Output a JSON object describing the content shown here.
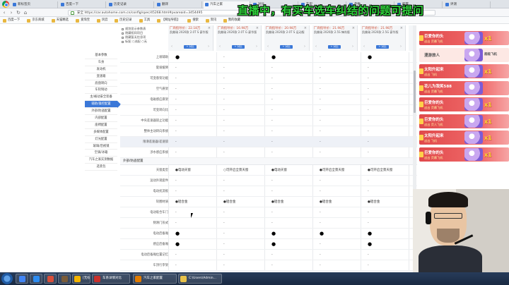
{
  "browser": {
    "tabs": [
      {
        "label": "新标签页",
        "active": false
      },
      {
        "label": "百度一下",
        "active": false
      },
      {
        "label": "历史记录",
        "active": false
      },
      {
        "label": "翻译",
        "active": false
      },
      {
        "label": "汽车之家",
        "active": true
      },
      {
        "label": "对比",
        "active": false
      },
      {
        "label": "车型",
        "active": false
      },
      {
        "label": "参数",
        "active": false
      },
      {
        "label": "配置",
        "active": false
      },
      {
        "label": "评测",
        "active": false
      }
    ],
    "url": "https://car.autohome.com.cn/config/spec/45268.html#pvareaid=3454495",
    "secure_label": "安全"
  },
  "bookmarks": [
    "百度一下",
    "京东商城",
    "天猫精选",
    "爱淘宝",
    "风云",
    "历史记录",
    "工具",
    "【网址导航】",
    "搜索",
    "资讯",
    "我的收藏"
  ],
  "banner": "直播中，有买车选车纠结的问题可提问",
  "tree": [
    "规划显示参数表",
    "隐藏相同项目",
    "隐藏暂无信息项",
    "标配  ○选配  ○无"
  ],
  "columns": [
    {
      "price": "厂商指导价：22.18万",
      "name": "凯美瑞 2020款 2.0T S 豪华版",
      "add": "+ 对比"
    },
    {
      "price": "厂商指导价：16.98万",
      "name": "凯美瑞 2020款 2.0T G 豪华版",
      "add": "+ 对比"
    },
    {
      "price": "厂商指导价：20.98万",
      "name": "凯美瑞 2020款 2.0T S 运动版",
      "add": "+ 对比"
    },
    {
      "price": "厂商指导价：21.98万",
      "name": "凯美瑞 2020款 2.5S 锋尚版",
      "add": "+ 对比"
    },
    {
      "price": "厂商指导价：21.98万",
      "name": "凯美瑞 2020款 2.5G 豪华版",
      "add": "+ 对比"
    },
    {
      "price": "厂商指导价：24.98万",
      "name": "凯美瑞 2020款 2.5Q 旗舰版",
      "add": "+ 对比"
    }
  ],
  "sidenav": {
    "items": [
      "基本参数",
      "车身",
      "发动机",
      "变速箱",
      "底盘转向",
      "车轮制动",
      "主/被动安全装备",
      "辅助/操控配置",
      "外部/防盗配置",
      "内部配置",
      "座椅配置",
      "多媒体配置",
      "灯光配置",
      "玻璃/后视镜",
      "空调/冰箱",
      "汽车之家实测数据",
      "选装包"
    ],
    "active_index": 7
  },
  "table": {
    "rows_top": [
      {
        "label": "上坡辅助",
        "cells": [
          "●",
          "-",
          "●",
          "-",
          "●",
          "-"
        ]
      },
      {
        "label": "陡坡缓降",
        "cells": [
          "-",
          "-",
          "-",
          "-",
          "-",
          "-"
        ]
      },
      {
        "label": "可变悬架功能",
        "cells": [
          "-",
          "-",
          "-",
          "-",
          "-",
          "-"
        ]
      },
      {
        "label": "空气悬架",
        "cells": [
          "-",
          "-",
          "-",
          "-",
          "-",
          "-"
        ]
      },
      {
        "label": "电磁感应悬架",
        "cells": [
          "-",
          "-",
          "-",
          "-",
          "-",
          "-"
        ]
      },
      {
        "label": "可变转向比",
        "cells": [
          "-",
          "-",
          "-",
          "-",
          "-",
          "-"
        ]
      },
      {
        "label": "中央差速器锁止功能",
        "cells": [
          "-",
          "-",
          "-",
          "-",
          "-",
          "-"
        ]
      },
      {
        "label": "整体主动转向系统",
        "cells": [
          "-",
          "-",
          "-",
          "-",
          "-",
          "-"
        ]
      },
      {
        "label": "限滑差速器/差速锁",
        "cells": [
          "-",
          "-",
          "-",
          "-",
          "-",
          "-"
        ]
      },
      {
        "label": "涉水感应系统",
        "cells": [
          "-",
          "-",
          "-",
          "-",
          "-",
          "-"
        ]
      }
    ],
    "section_label": "外部/防盗配置",
    "rows_bottom": [
      {
        "label": "天窗类型",
        "cells": [
          "●电动天窗",
          "○可开启全景天窗",
          "●电动天窗",
          "●可开启全景天窗",
          "●可开启全景天窗",
          "●可开启全景天窗"
        ]
      },
      {
        "label": "运动外观套件",
        "cells": [
          "-",
          "-",
          "-",
          "-",
          "-",
          "-"
        ]
      },
      {
        "label": "电动扰流板",
        "cells": [
          "-",
          "-",
          "-",
          "-",
          "-",
          "-"
        ]
      },
      {
        "label": "轮圈材质",
        "cells": [
          "●铝合金",
          "●铝合金",
          "●铝合金",
          "●铝合金",
          "●铝合金",
          "●铝合金"
        ]
      },
      {
        "label": "电动吸合车门",
        "cells": [
          "-",
          "-",
          "-",
          "-",
          "-",
          "-"
        ]
      },
      {
        "label": "侧滑门形式",
        "cells": [
          "-",
          "-",
          "-",
          "-",
          "-",
          "-"
        ]
      },
      {
        "label": "电动后备厢",
        "cells": [
          "●",
          "-",
          "●",
          "●",
          "●",
          "●"
        ]
      },
      {
        "label": "感应后备厢",
        "cells": [
          "●",
          "-",
          "●",
          "-",
          "●",
          "-"
        ]
      },
      {
        "label": "电动后备厢位置记忆",
        "cells": [
          "-",
          "-",
          "-",
          "-",
          "-",
          "-"
        ]
      },
      {
        "label": "车顶行李架",
        "cells": [
          "-",
          "-",
          "-",
          "-",
          "-",
          "-"
        ]
      }
    ]
  },
  "gifts": [
    {
      "user": "巨爱你的头",
      "sub": "送出  荧幕飞机",
      "count": "x1",
      "plain": false
    },
    {
      "user": "漫游旅人",
      "sub": "",
      "count": "",
      "gift_label": "超级飞机",
      "plain": true
    },
    {
      "user": "太阳升起来",
      "sub": "送出  飞机",
      "count": "x1",
      "plain": false
    },
    {
      "user": "花儿为我笑588",
      "sub": "送出  荧幕飞机",
      "count": "",
      "plain": false
    },
    {
      "user": "巨爱你的头",
      "sub": "送出  荧幕飞机",
      "count": "x1",
      "plain": false
    },
    {
      "user": "巨爱你的头",
      "sub": "送出  荧人飞机",
      "count": "x1",
      "plain": false
    },
    {
      "user": "太阳升起来",
      "sub": "送出  飞机",
      "count": "x1",
      "plain": false
    },
    {
      "user": "巨爱你的头",
      "sub": "送出  荧幕飞机",
      "count": "x1",
      "plain": false
    }
  ],
  "taskbar": {
    "tasks": [
      "[无标题] - 汽车之家",
      "车系详情对比",
      "汽车之家配置",
      "C:\\Users\\Admin..."
    ]
  }
}
